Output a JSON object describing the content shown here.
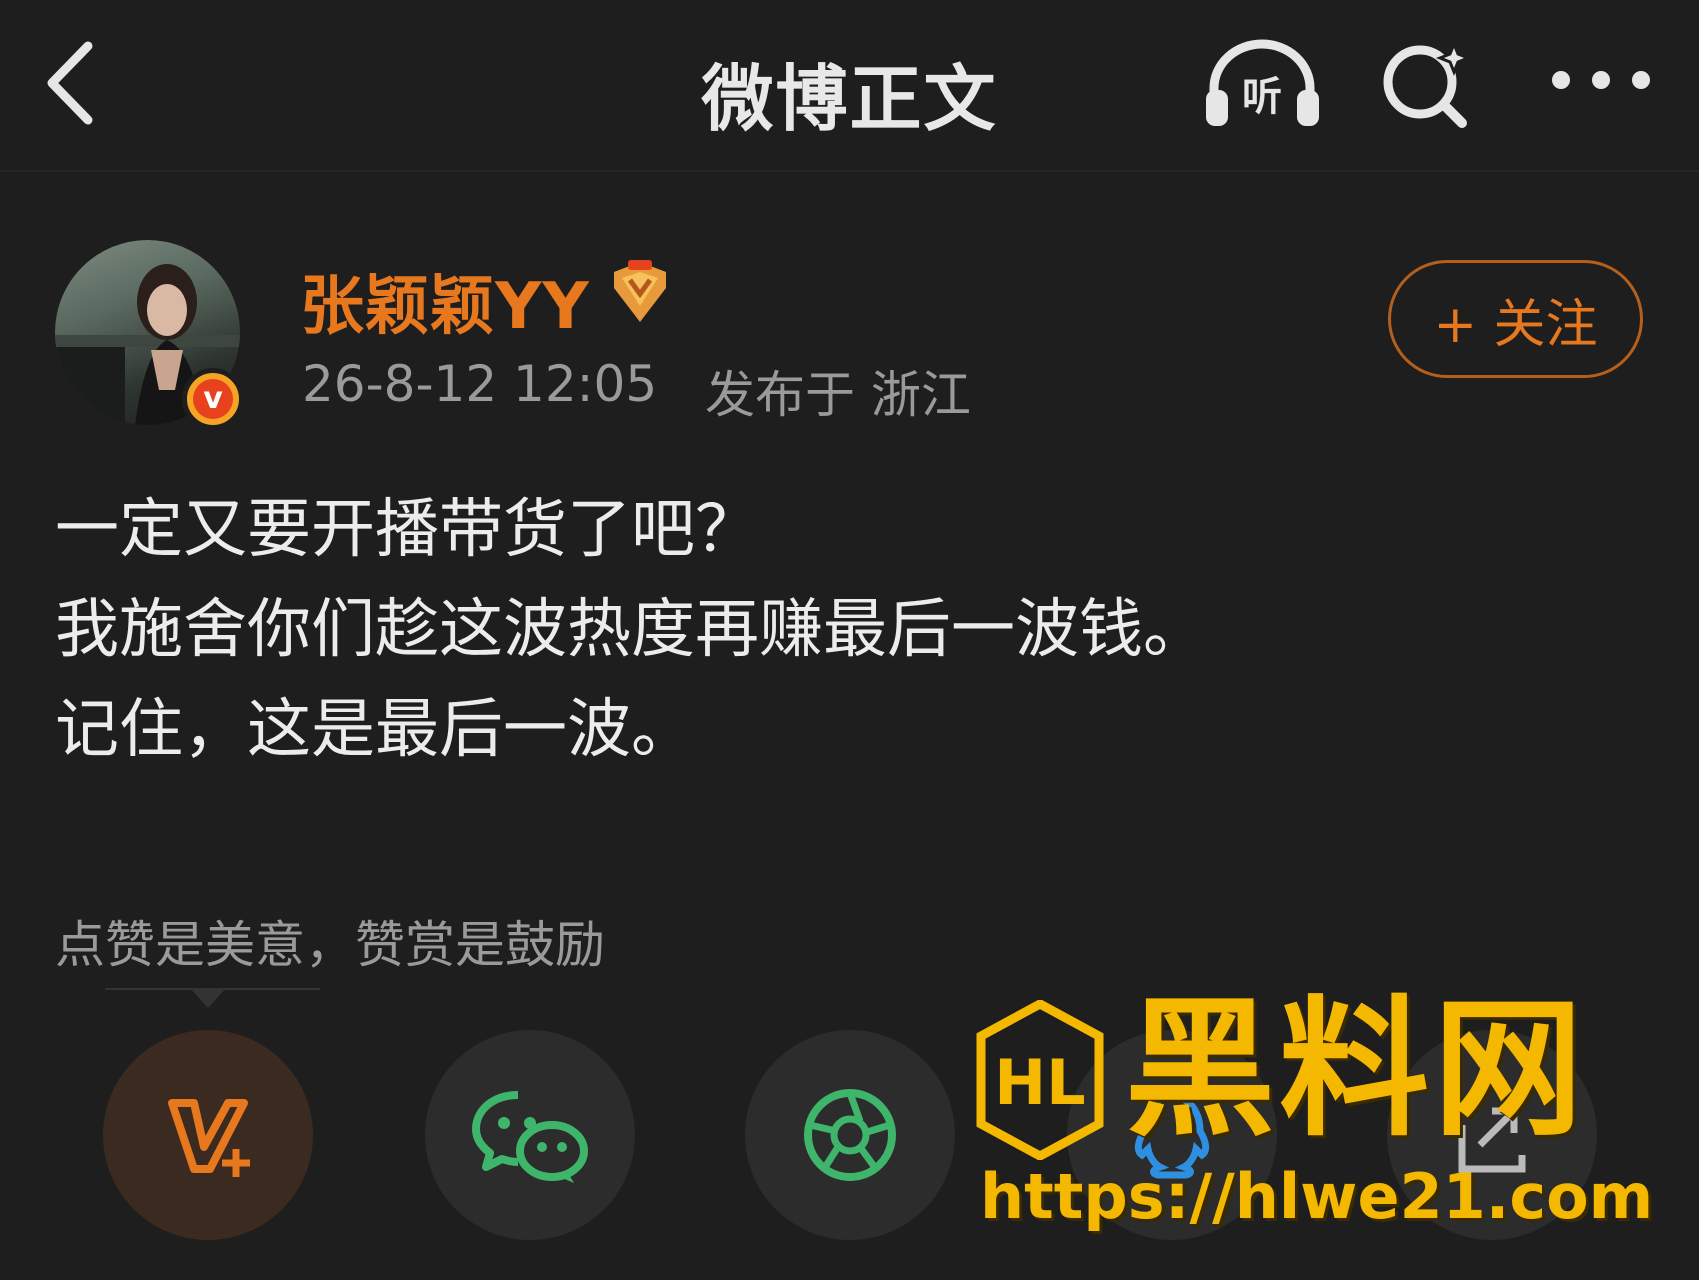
{
  "header": {
    "title": "微博正文",
    "listen_label": "听",
    "icons": [
      "back-icon",
      "listen-icon",
      "search-icon",
      "more-icon"
    ]
  },
  "post": {
    "author": "张颖颖YY",
    "time": "26-8-12 12:05",
    "location": "发布于 浙江",
    "follow_label": "+ 关注",
    "lines": [
      "一定又要开播带货了吧？",
      "我施舍你们趁这波热度再赚最后一波钱。",
      "记住，这是最后一波。"
    ]
  },
  "reward_hint": "点赞是美意，赞赏是鼓励",
  "share": {
    "buttons": [
      "vplus-icon",
      "wechat-icon",
      "moments-icon",
      "qq-icon",
      "export-icon"
    ]
  },
  "watermark": {
    "title": "黑料网",
    "url": "https://hlwe21.com",
    "logo_text": "HL"
  },
  "colors": {
    "background": "#1e1e1e",
    "accent": "#e8781e",
    "muted": "#9a9a9a",
    "watermark": "#f5b800",
    "wechat_green": "#3fb56b"
  }
}
